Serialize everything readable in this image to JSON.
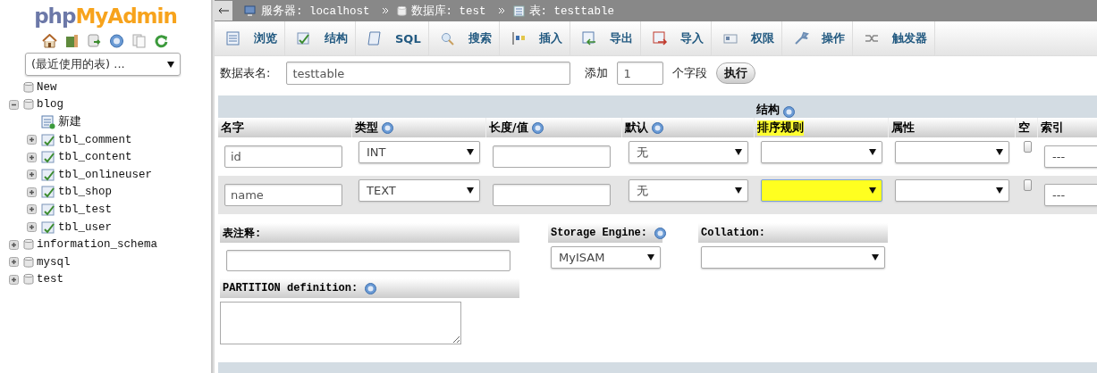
{
  "sidebar": {
    "logo": {
      "prefix": "php",
      "name": "MyAdmin"
    },
    "recent_tables": {
      "value": "(最近使用的表) ..."
    },
    "tree": [
      {
        "label": "New",
        "kind": "new"
      },
      {
        "label": "blog",
        "kind": "database",
        "expanded": true,
        "children": [
          {
            "label": "新建",
            "kind": "new-table"
          },
          {
            "label": "tbl_comment",
            "kind": "table",
            "expanded": false
          },
          {
            "label": "tbl_content",
            "kind": "table",
            "expanded": false
          },
          {
            "label": "tbl_onlineuser",
            "kind": "table",
            "expanded": false
          },
          {
            "label": "tbl_shop",
            "kind": "table",
            "expanded": false
          },
          {
            "label": "tbl_test",
            "kind": "table",
            "expanded": false
          },
          {
            "label": "tbl_user",
            "kind": "table",
            "expanded": false
          }
        ]
      },
      {
        "label": "information_schema",
        "kind": "database",
        "expanded": false
      },
      {
        "label": "mysql",
        "kind": "database",
        "expanded": false
      },
      {
        "label": "test",
        "kind": "database",
        "expanded": false
      }
    ]
  },
  "breadcrumb": [
    {
      "label": "服务器: localhost",
      "kind": "server"
    },
    {
      "label": "数据库: test",
      "kind": "database"
    },
    {
      "label": "表: testtable",
      "kind": "table"
    }
  ],
  "tabs": [
    {
      "label": "浏览",
      "kind": "browse",
      "selected": false
    },
    {
      "label": "结构",
      "kind": "structure",
      "selected": false
    },
    {
      "label": "SQL",
      "kind": "sql",
      "selected": false
    },
    {
      "label": "搜索",
      "kind": "search",
      "selected": false
    },
    {
      "label": "插入",
      "kind": "insert",
      "selected": false
    },
    {
      "label": "导出",
      "kind": "export",
      "selected": false
    },
    {
      "label": "导入",
      "kind": "import",
      "selected": false
    },
    {
      "label": "权限",
      "kind": "privileges",
      "selected": false
    },
    {
      "label": "操作",
      "kind": "operations",
      "selected": false
    },
    {
      "label": "触发器",
      "kind": "triggers",
      "selected": false
    }
  ],
  "form": {
    "table_name_label": "数据表名:",
    "table_name": "testtable",
    "add_label": "添加",
    "add_count": "1",
    "fields_label": "个字段",
    "go_button": "执行"
  },
  "structure": {
    "title": "结构",
    "columns": [
      {
        "label": "名字",
        "help": false,
        "highlighted": false
      },
      {
        "label": "类型",
        "help": true,
        "highlighted": false
      },
      {
        "label": "长度/值",
        "help": true,
        "highlighted": false
      },
      {
        "label": "默认",
        "help": true,
        "highlighted": false
      },
      {
        "label": "排序规则",
        "help": false,
        "highlighted": true
      },
      {
        "label": "属性",
        "help": false,
        "highlighted": false
      },
      {
        "label": "空",
        "help": false,
        "highlighted": false
      },
      {
        "label": "索引",
        "help": false,
        "highlighted": false
      }
    ],
    "rows": [
      {
        "name": "id",
        "type": "INT",
        "default": "无",
        "null": false,
        "index": "---",
        "collation_highlighted": false
      },
      {
        "name": "name",
        "type": "TEXT",
        "default": "无",
        "null": false,
        "index": "---",
        "collation_highlighted": true
      }
    ]
  },
  "options": {
    "comment": {
      "label": "表注释:"
    },
    "storage_engine": {
      "label": "Storage Engine:",
      "help": true,
      "value": "MyISAM"
    },
    "collation": {
      "label": "Collation:"
    },
    "partition": {
      "label": "PARTITION definition:",
      "help": true
    }
  }
}
